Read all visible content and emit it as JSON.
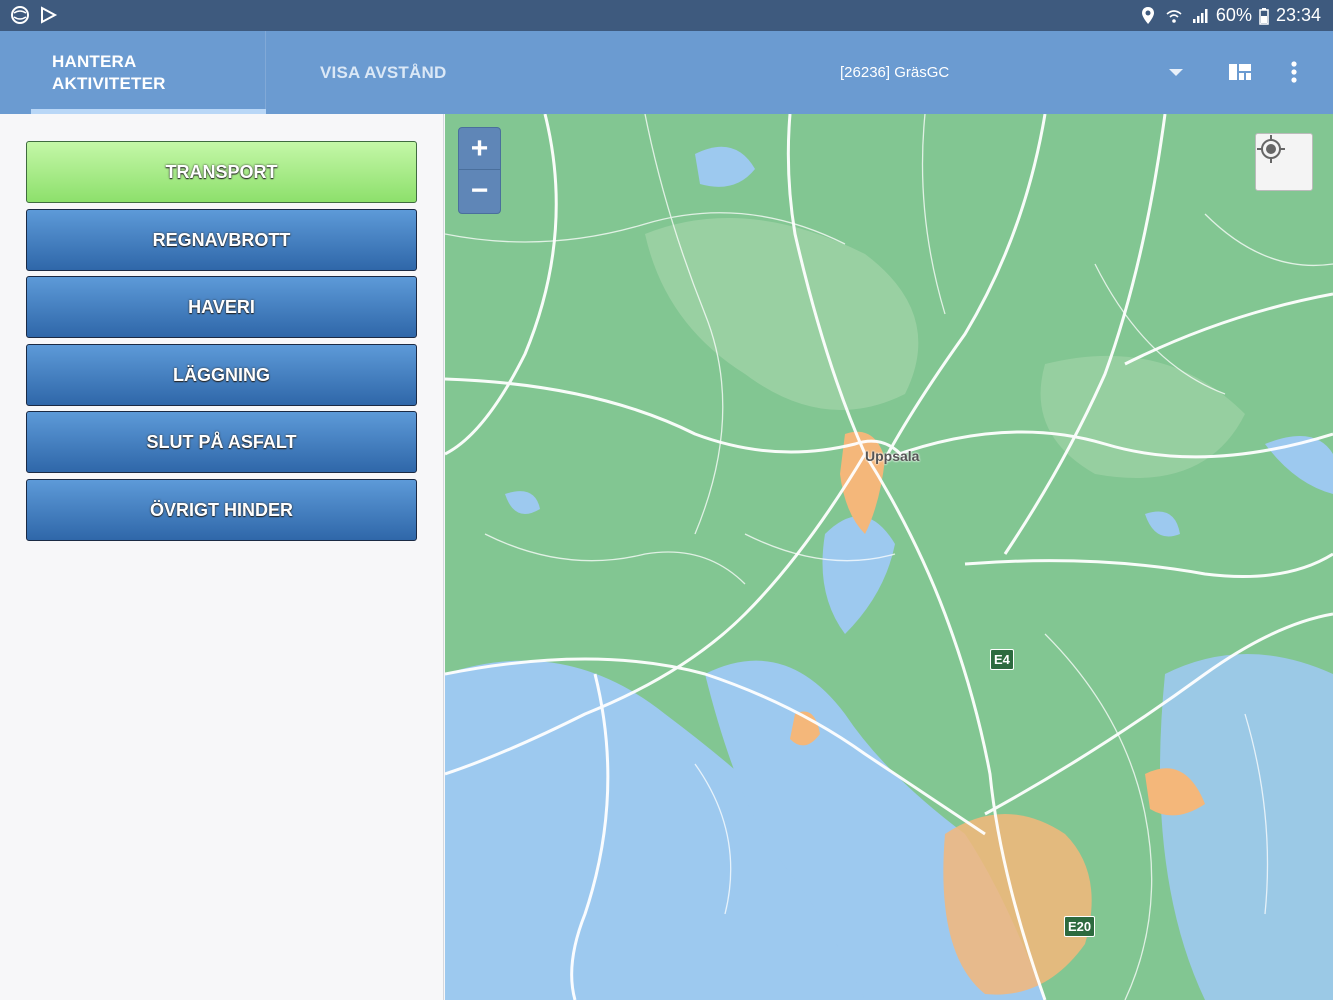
{
  "status_bar": {
    "battery": "60%",
    "time": "23:34",
    "icons": [
      "globe-icon",
      "play-store-icon",
      "location-pin-icon",
      "wifi-icon",
      "signal-icon",
      "battery-icon"
    ]
  },
  "appbar": {
    "tabs": [
      {
        "label_line1": "HANTERA",
        "label_line2": "AKTIVITETER",
        "selected": true
      },
      {
        "label": "VISA AVSTÅND",
        "selected": false
      }
    ],
    "spinner_value": "[26236] GräsGC",
    "icons": [
      "dashboard-icon",
      "overflow-menu-icon"
    ]
  },
  "activities": [
    {
      "label": "TRANSPORT",
      "active": true
    },
    {
      "label": "REGNAVBROTT",
      "active": false
    },
    {
      "label": "HAVERI",
      "active": false
    },
    {
      "label": "LÄGGNING",
      "active": false
    },
    {
      "label": "SLUT PÅ ASFALT",
      "active": false
    },
    {
      "label": "ÖVRIGT HINDER",
      "active": false
    }
  ],
  "map": {
    "zoom_in": "+",
    "zoom_out": "−",
    "city_label": "Uppsala",
    "road_shields": [
      "E4",
      "E20"
    ],
    "colors": {
      "land": "#7fc58d",
      "water": "#9dc9ef",
      "urban": "#f4b77a",
      "roads": "#ffffff"
    }
  }
}
